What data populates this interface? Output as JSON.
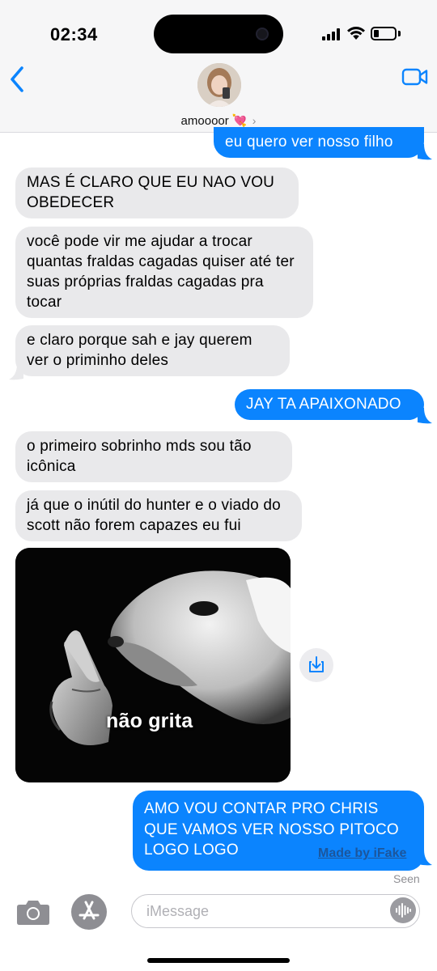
{
  "status_bar": {
    "time": "02:34",
    "battery_level": 0.25
  },
  "header": {
    "back_icon": "chevron-left-icon",
    "contact_name": "amoooor",
    "contact_emoji": "💘",
    "detail_chevron": "›",
    "video_icon": "video-camera-icon",
    "accent_color": "#0b84fe"
  },
  "messages": [
    {
      "from": "me",
      "text": "eu quero ver nosso filho"
    },
    {
      "from": "them",
      "text": "MAS É CLARO QUE EU NAO VOU OBEDECER"
    },
    {
      "from": "them",
      "text": "você pode vir me ajudar a trocar quantas fraldas cagadas quiser até ter suas próprias fraldas cagadas pra tocar"
    },
    {
      "from": "them",
      "text": "e claro porque sah e jay querem ver o priminho deles"
    },
    {
      "from": "me",
      "text": "JAY TA APAIXONADO"
    },
    {
      "from": "them",
      "text": "o primeiro sobrinho mds sou tão icônica"
    },
    {
      "from": "them",
      "text": "já que o inútil do hunter e o viado do scott não forem capazes eu fui"
    },
    {
      "from": "them",
      "type": "image",
      "caption": "não grita"
    },
    {
      "from": "me",
      "text": "AMO VOU CONTAR PRO CHRIS QUE VAMOS VER NOSSO PITOCO LOGO LOGO"
    }
  ],
  "watermark": "Made by iFake",
  "read_receipt": "Seen",
  "composer": {
    "placeholder": "iMessage",
    "camera_icon": "camera-icon",
    "apps_icon": "app-store-icon",
    "audio_icon": "audio-waveform-icon"
  },
  "colors": {
    "sent_bubble": "#0b84fe",
    "received_bubble": "#e9e9eb",
    "header_bg": "#f6f6f7"
  }
}
